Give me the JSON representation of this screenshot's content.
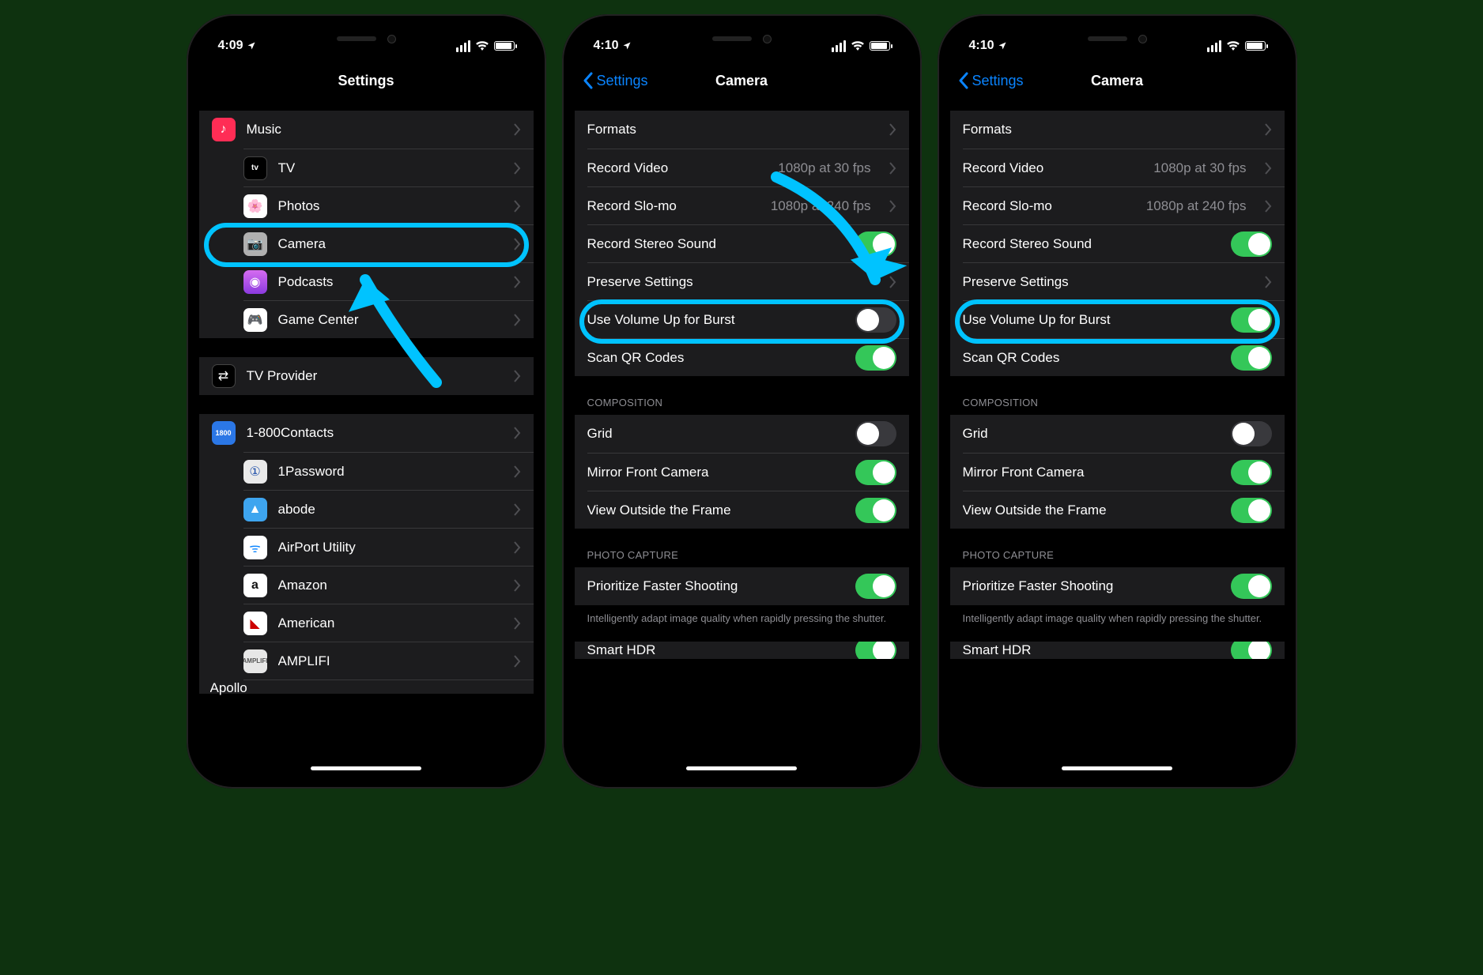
{
  "phone1": {
    "time": "4:09",
    "nav_title": "Settings",
    "group1": [
      {
        "name": "music",
        "label": "Music",
        "iconBg": "#ff3b30",
        "glyph": "♪"
      },
      {
        "name": "tv",
        "label": "TV",
        "iconBg": "#000",
        "glyph": "tv",
        "border": "#444"
      },
      {
        "name": "photos",
        "label": "Photos",
        "iconBg": "#fff",
        "glyph": "✿"
      },
      {
        "name": "camera",
        "label": "Camera",
        "iconBg": "#a8a8a8",
        "glyph": "📷"
      },
      {
        "name": "podcasts",
        "label": "Podcasts",
        "iconBg": "#a951df",
        "glyph": "◉"
      },
      {
        "name": "gamecenter",
        "label": "Game Center",
        "iconBg": "#fff",
        "glyph": "◐"
      }
    ],
    "group2": [
      {
        "name": "tvprovider",
        "label": "TV Provider",
        "iconBg": "#000",
        "glyph": "⇄",
        "border": "#444"
      }
    ],
    "group3": [
      {
        "name": "1800contacts",
        "label": "1-800Contacts",
        "iconBg": "#2b77e6",
        "glyph": "1800"
      },
      {
        "name": "1password",
        "label": "1Password",
        "iconBg": "#e7e7e7",
        "glyph": "①"
      },
      {
        "name": "abode",
        "label": "abode",
        "iconBg": "#3ea5ef",
        "glyph": "▲"
      },
      {
        "name": "airport",
        "label": "AirPort Utility",
        "iconBg": "#fff",
        "glyph": "ᯤ"
      },
      {
        "name": "amazon",
        "label": "Amazon",
        "iconBg": "#fff",
        "glyph": "a"
      },
      {
        "name": "american",
        "label": "American",
        "iconBg": "#fff",
        "glyph": "◣"
      },
      {
        "name": "amplifi",
        "label": "AMPLIFI",
        "iconBg": "#e7e7e7",
        "glyph": "···"
      },
      {
        "name": "apollo",
        "label": "Apollo",
        "iconBg": "#3b5bdb",
        "glyph": "◉"
      }
    ]
  },
  "camera": {
    "nav_back": "Settings",
    "nav_title": "Camera",
    "rows": {
      "formats": "Formats",
      "record_video": "Record Video",
      "record_video_detail": "1080p at 30 fps",
      "record_slomo": "Record Slo-mo",
      "record_slomo_detail": "1080p at 240 fps",
      "stereo": "Record Stereo Sound",
      "preserve": "Preserve Settings",
      "burst": "Use Volume Up for Burst",
      "qr": "Scan QR Codes"
    },
    "composition": {
      "header": "COMPOSITION",
      "grid": "Grid",
      "mirror": "Mirror Front Camera",
      "view": "View Outside the Frame"
    },
    "photo": {
      "header": "PHOTO CAPTURE",
      "prioritize": "Prioritize Faster Shooting",
      "footer": "Intelligently adapt image quality when rapidly pressing the shutter.",
      "hdr": "Smart HDR"
    }
  },
  "phone2": {
    "time": "4:10",
    "burst_on": false
  },
  "phone3": {
    "time": "4:10",
    "burst_on": true
  }
}
